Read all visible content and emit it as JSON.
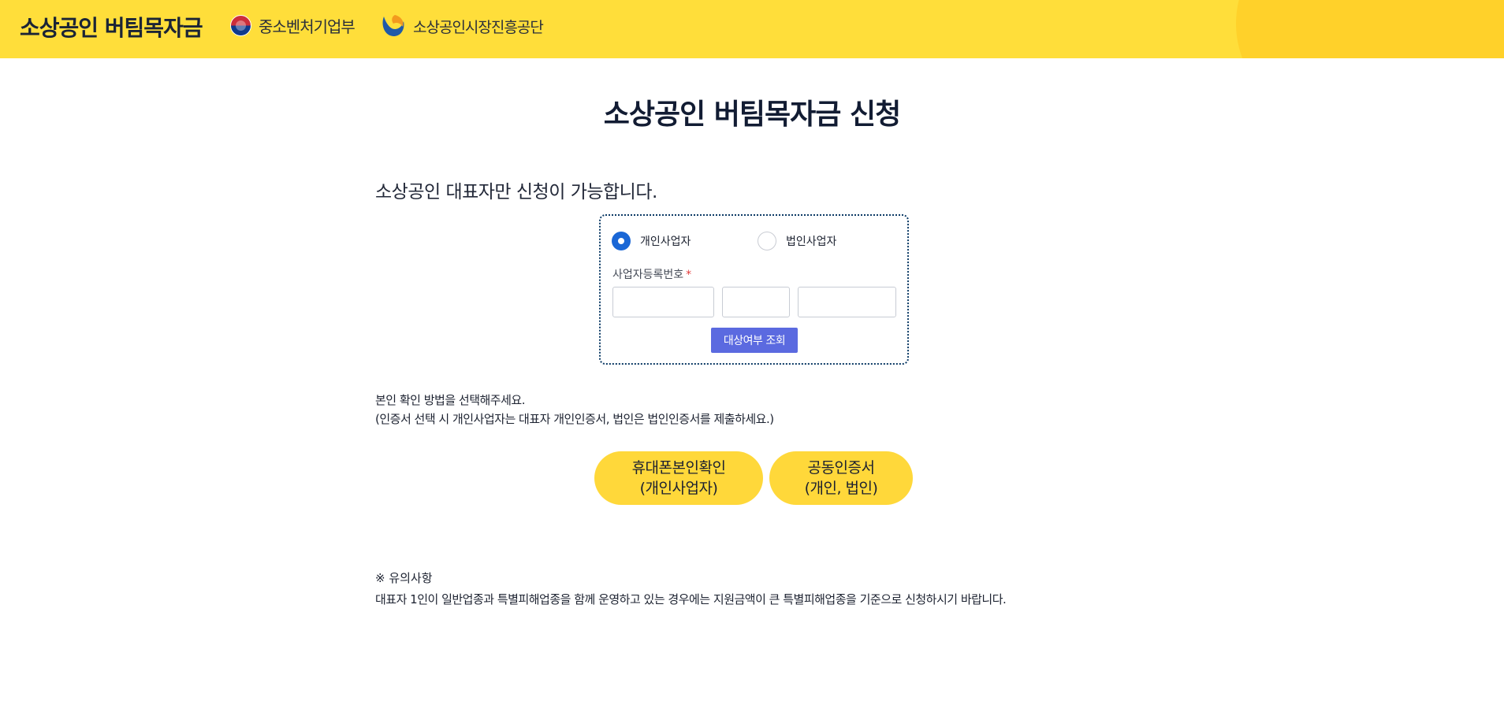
{
  "header": {
    "brand": "소상공인 버팀목자금",
    "ministry": "중소벤처기업부",
    "agency": "소상공인시장진흥공단",
    "colors": {
      "background": "#ffde3a",
      "accent": "#ffd12a"
    }
  },
  "main": {
    "title": "소상공인 버팀목자금 신청",
    "subtitle": "소상공인 대표자만 신청이 가능합니다.",
    "form": {
      "business_types": [
        {
          "label": "개인사업자",
          "selected": true
        },
        {
          "label": "법인사업자",
          "selected": false
        }
      ],
      "reg_number_label": "사업자등록번호",
      "required_mark": "*",
      "reg_parts": [
        {
          "value": "",
          "placeholder": ""
        },
        {
          "value": "",
          "placeholder": ""
        },
        {
          "value": "",
          "placeholder": ""
        }
      ],
      "query_button": "대상여부 조회"
    },
    "verify": {
      "line1": "본인 확인 방법을 선택해주세요.",
      "line2": "(인증서 선택 시 개인사업자는 대표자 개인인증서, 법인은 법인인증서를 제출하세요.)"
    },
    "auth_buttons": [
      {
        "line1": "휴대폰본인확인",
        "line2": "(개인사업자)"
      },
      {
        "line1": "공동인증서",
        "line2": "(개인, 법인)"
      }
    ],
    "notice": {
      "title": "※ 유의사항",
      "body": "대표자 1인이 일반업종과 특별피해업종을 함께 운영하고 있는 경우에는 지원금액이 큰 특별피해업종을 기준으로 신청하시기 바랍니다."
    }
  },
  "colors": {
    "primary_blue": "#1a67d6",
    "button_purple": "#5b6ae0",
    "button_yellow": "#ffd83a",
    "form_border": "#0d3b66"
  }
}
